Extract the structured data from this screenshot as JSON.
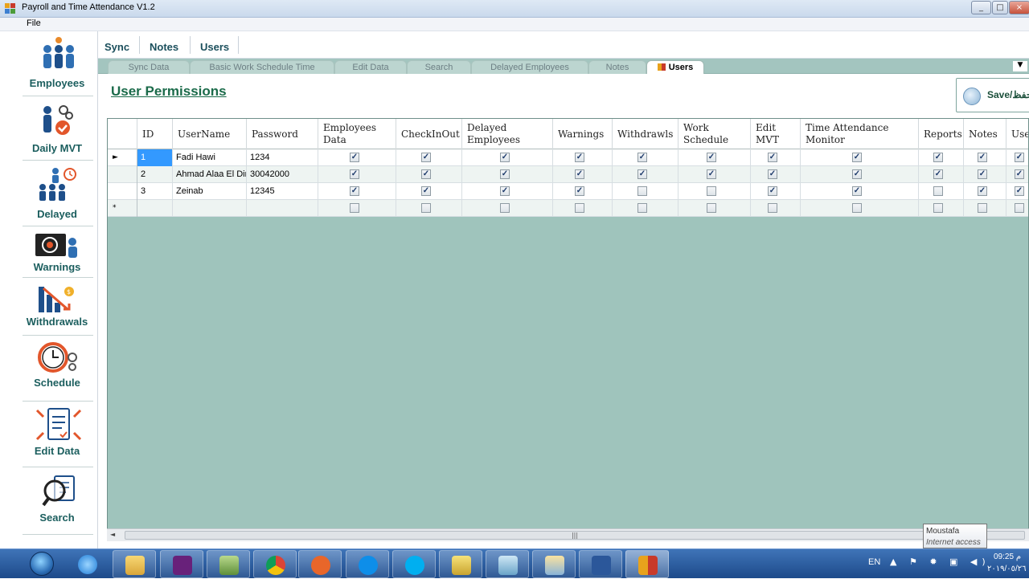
{
  "window": {
    "title": "Payroll and Time Attendance V1.2",
    "controls": [
      "_",
      "□",
      "×"
    ]
  },
  "menu": {
    "file": "File"
  },
  "sidebar": {
    "items": [
      {
        "label": "Employees",
        "icon": "employees-icon"
      },
      {
        "label": "Daily MVT",
        "icon": "daily-mvt-icon"
      },
      {
        "label": "Delayed",
        "icon": "delayed-icon"
      },
      {
        "label": "Warnings",
        "icon": "warnings-icon"
      },
      {
        "label": "Withdrawals",
        "icon": "withdrawals-icon"
      },
      {
        "label": "Schedule",
        "icon": "schedule-icon"
      },
      {
        "label": "Edit Data",
        "icon": "edit-data-icon"
      },
      {
        "label": "Search",
        "icon": "search-icon"
      }
    ]
  },
  "ribbon": {
    "tabs": [
      "Sync",
      "Notes",
      "Users"
    ]
  },
  "subtabs": {
    "items": [
      "Sync Data",
      "Basic Work Schedule Time",
      "Edit Data",
      "Search",
      "Delayed Employees",
      "Notes",
      "Users"
    ],
    "active": "Users"
  },
  "page": {
    "title": "User Permissions",
    "save_label": "Save/حفظ"
  },
  "table": {
    "columns": [
      "ID",
      "UserName",
      "Password",
      "Employees Data",
      "CheckInOut",
      "Delayed Employees",
      "Warnings",
      "Withdrawls",
      "Work Schedule",
      "Edit MVT",
      "Time Attendance Monitor",
      "Reports",
      "Notes",
      "User"
    ],
    "rows": [
      {
        "id": "1",
        "username": "Fadi Hawi",
        "password": "1234",
        "perms": [
          true,
          true,
          true,
          true,
          true,
          true,
          true,
          true,
          true,
          true,
          true
        ]
      },
      {
        "id": "2",
        "username": "Ahmad Alaa El Din",
        "password": "30042000",
        "perms": [
          true,
          true,
          true,
          true,
          true,
          true,
          true,
          true,
          true,
          true,
          true
        ]
      },
      {
        "id": "3",
        "username": "Zeinab",
        "password": "12345",
        "perms": [
          true,
          true,
          true,
          true,
          false,
          false,
          true,
          true,
          false,
          true,
          true
        ]
      }
    ],
    "new_row_marker": "*",
    "current_row_marker": "►"
  },
  "taskbar": {
    "language": "EN",
    "time": "09:25 م",
    "date": "٢٠١٩/٠٥/٢٦"
  },
  "tooltip": {
    "line1": "Moustafa",
    "line2": "Internet access"
  },
  "colors": {
    "grid_background": "#9fc4bc",
    "subtab_bar": "#a3c5bf",
    "accent_green": "#1b6b4a",
    "selection": "#3399ff"
  }
}
